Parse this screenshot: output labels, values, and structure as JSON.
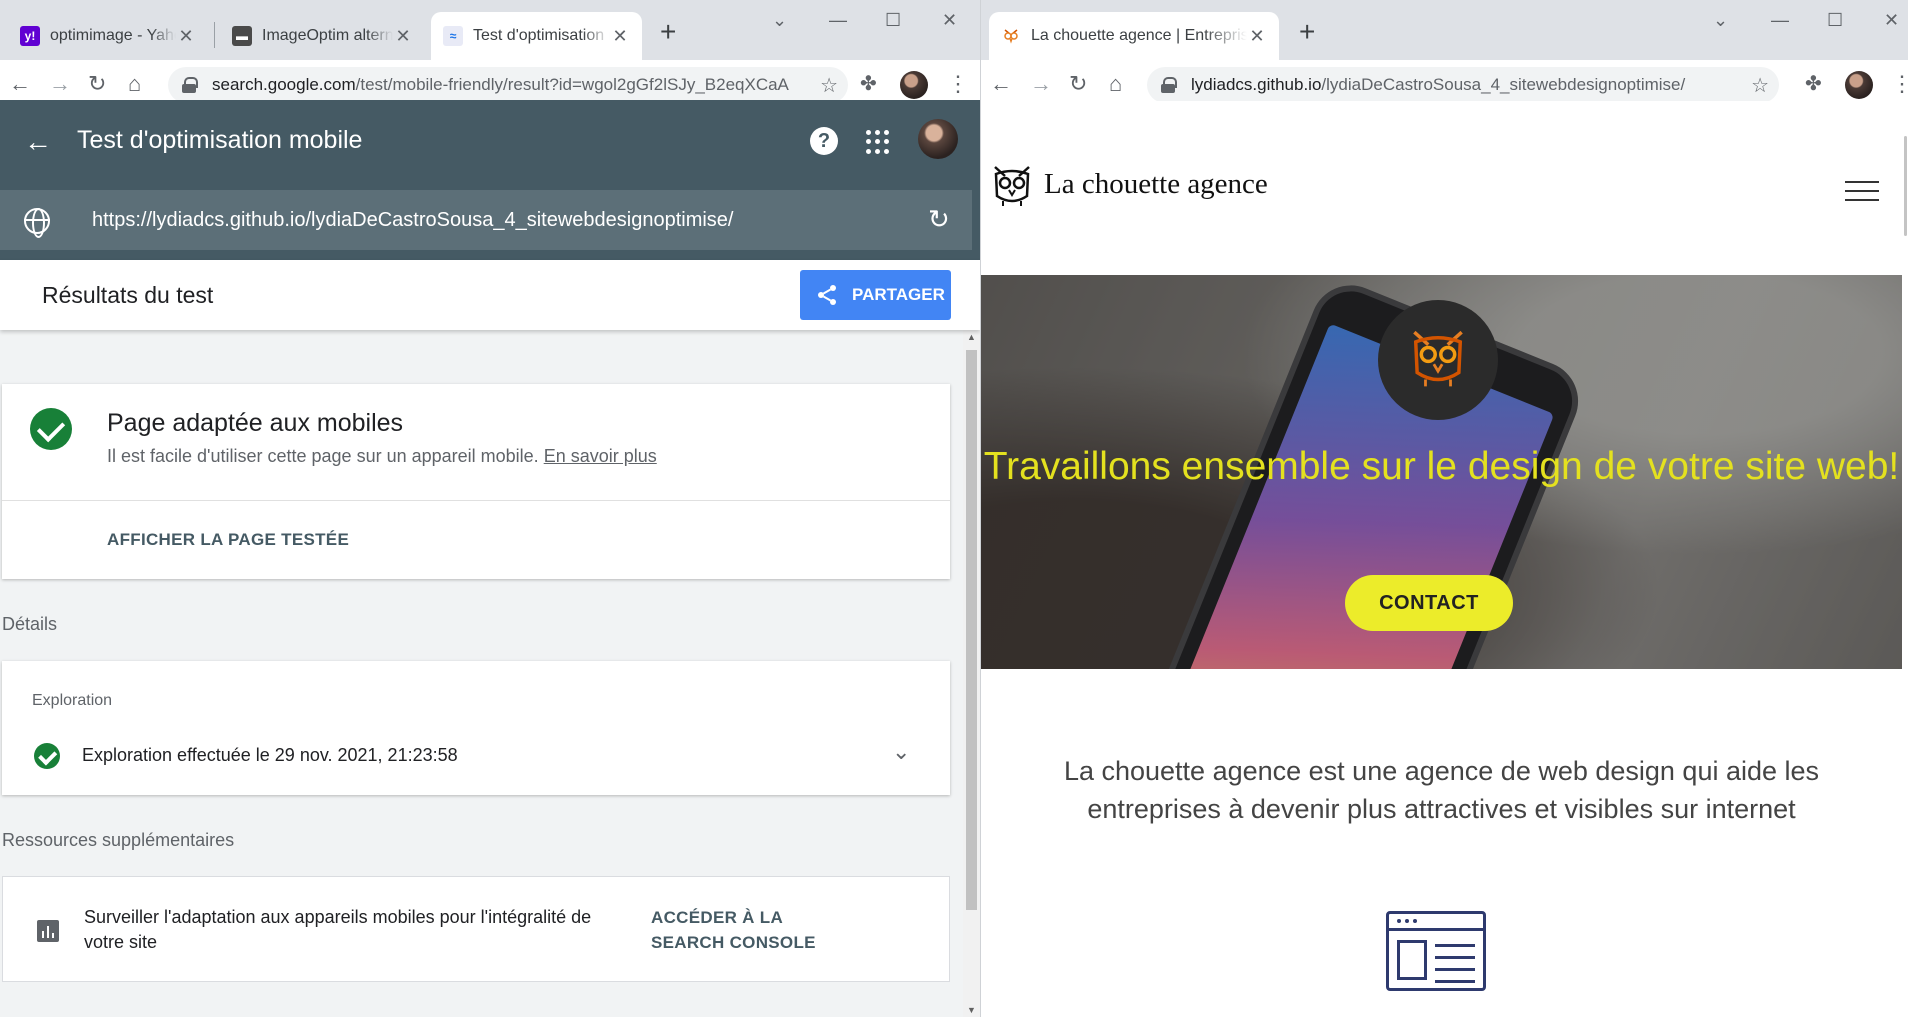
{
  "left_window": {
    "tabs": [
      {
        "title": "optimimage - Yahoo",
        "favicon": "yahoo-icon"
      },
      {
        "title": "ImageOptim alternative",
        "favicon": "imageoptim-icon"
      },
      {
        "title": "Test d'optimisation mobile",
        "favicon": "google-search-console-icon",
        "active": true
      }
    ],
    "address": {
      "host": "search.google.com",
      "path": "/test/mobile-friendly/result?id=wgol2gGf2lSJy_B2eqXCaA"
    },
    "page": {
      "header_title": "Test d'optimisation mobile",
      "tested_url": "https://lydiadcs.github.io/lydiaDeCastroSousa_4_sitewebdesignoptimise/",
      "results_title": "Résultats du test",
      "share_label": "PARTAGER",
      "verdict_title": "Page adaptée aux mobiles",
      "verdict_desc": "Il est facile d'utiliser cette page sur un appareil mobile.",
      "learn_more": "En savoir plus",
      "view_tested_page": "AFFICHER LA PAGE TESTÉE",
      "details_label": "Détails",
      "crawl_section": "Exploration",
      "crawl_status": "Exploration effectuée le 29 nov. 2021, 21:23:58",
      "resources_label": "Ressources supplémentaires",
      "monitor_text": "Surveiller l'adaptation aux appareils mobiles pour l'intégralité de votre site",
      "console_link": "ACCÉDER À LA SEARCH CONSOLE"
    },
    "colors": {
      "header_bg": "#455a64",
      "share_bg": "#4285f4",
      "success": "#188038"
    }
  },
  "right_window": {
    "tabs": [
      {
        "title": "La chouette agence | Entreprise de web design",
        "favicon": "owl-icon",
        "active": true
      }
    ],
    "address": {
      "host": "lydiadcs.github.io",
      "path": "/lydiaDeCastroSousa_4_sitewebdesignoptimise/"
    },
    "page": {
      "brand": "La chouette agence",
      "hero_title": "Travaillons ensemble sur le design de votre site web!",
      "contact_label": "CONTACT",
      "intro": "La chouette agence est une agence de web design qui aide les entreprises à devenir plus attractives et visibles sur internet"
    },
    "colors": {
      "hero_text": "#e4e11f",
      "contact_bg": "#ecec2a"
    }
  }
}
